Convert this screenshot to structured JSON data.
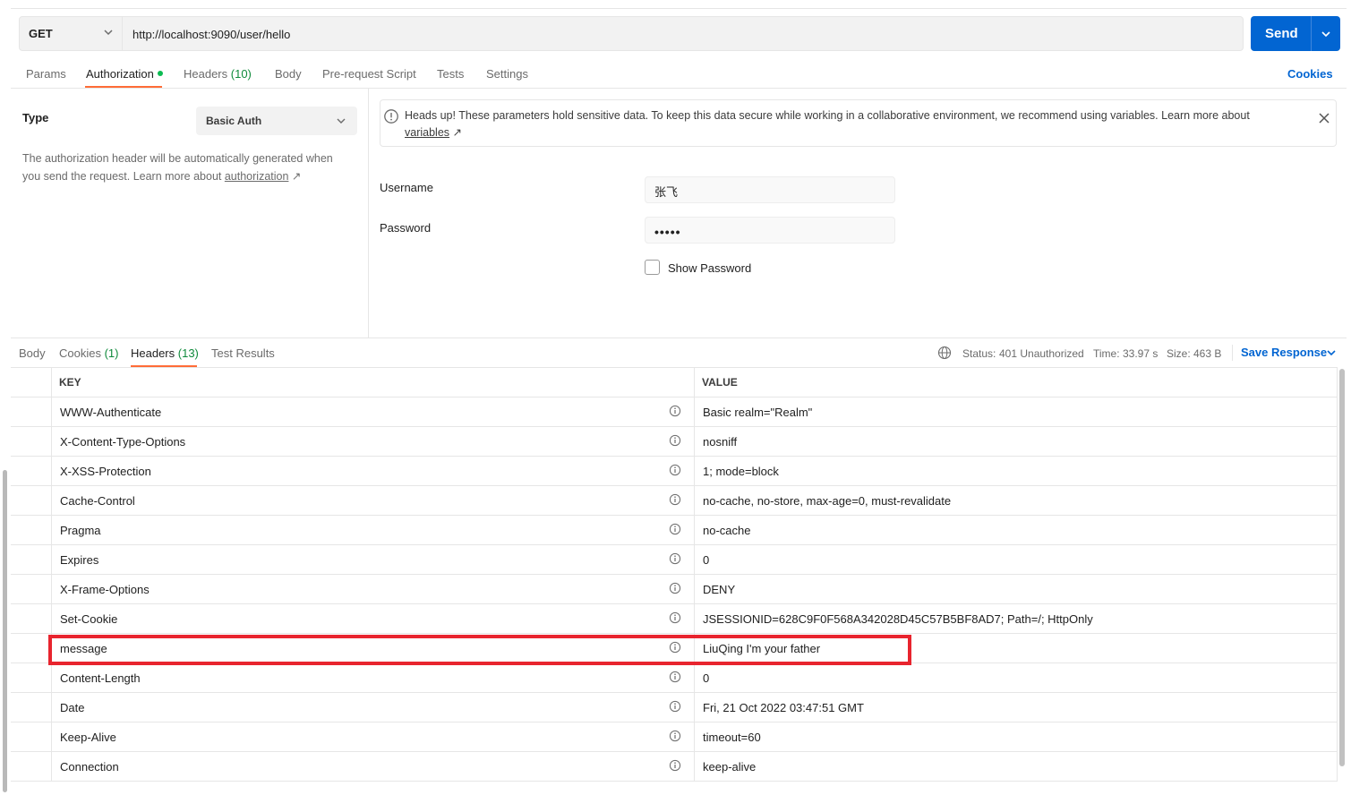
{
  "request": {
    "method": "GET",
    "url": "http://localhost:9090/user/hello",
    "send_label": "Send"
  },
  "request_tabs": {
    "params": "Params",
    "authorization": "Authorization",
    "headers": "Headers",
    "headers_count": "(10)",
    "body": "Body",
    "pre_request": "Pre-request Script",
    "tests": "Tests",
    "settings": "Settings",
    "cookies": "Cookies"
  },
  "auth": {
    "type_label": "Type",
    "type_value": "Basic Auth",
    "description": "The authorization header will be automatically generated when you send the request. Learn more about ",
    "description_link": "authorization",
    "banner_text": "Heads up! These parameters hold sensitive data. To keep this data secure while working in a collaborative environment, we recommend using variables. Learn more about ",
    "banner_link": "variables",
    "username_label": "Username",
    "username_value": "张飞",
    "password_label": "Password",
    "password_value": "•••••",
    "show_password": "Show Password"
  },
  "response_tabs": {
    "body": "Body",
    "cookies": "Cookies",
    "cookies_count": "(1)",
    "headers": "Headers",
    "headers_count": "(13)",
    "test_results": "Test Results"
  },
  "status": {
    "status_label": "Status:",
    "status_value": "401 Unauthorized",
    "time_label": "Time:",
    "time_value": "33.97 s",
    "size_label": "Size:",
    "size_value": "463 B",
    "save_response": "Save Response"
  },
  "table": {
    "key_header": "KEY",
    "value_header": "VALUE",
    "rows": [
      {
        "key": "WWW-Authenticate",
        "value": "Basic realm=\"Realm\""
      },
      {
        "key": "X-Content-Type-Options",
        "value": "nosniff"
      },
      {
        "key": "X-XSS-Protection",
        "value": "1; mode=block"
      },
      {
        "key": "Cache-Control",
        "value": "no-cache, no-store, max-age=0, must-revalidate"
      },
      {
        "key": "Pragma",
        "value": "no-cache"
      },
      {
        "key": "Expires",
        "value": "0"
      },
      {
        "key": "X-Frame-Options",
        "value": "DENY"
      },
      {
        "key": "Set-Cookie",
        "value": "JSESSIONID=628C9F0F568A342028D45C57B5BF8AD7; Path=/; HttpOnly"
      },
      {
        "key": "message",
        "value": "LiuQing I'm your father"
      },
      {
        "key": "Content-Length",
        "value": "0"
      },
      {
        "key": "Date",
        "value": "Fri, 21 Oct 2022 03:47:51 GMT"
      },
      {
        "key": "Keep-Alive",
        "value": "timeout=60"
      },
      {
        "key": "Connection",
        "value": "keep-alive"
      }
    ]
  },
  "colors": {
    "accent": "#0265d2",
    "tab_underline": "#ff6c37",
    "status_green": "#0f8a3b",
    "highlight_red": "#e8242e"
  },
  "icons": [
    "chevron-down-icon",
    "info-icon",
    "close-icon",
    "globe-icon",
    "external-link-icon"
  ]
}
